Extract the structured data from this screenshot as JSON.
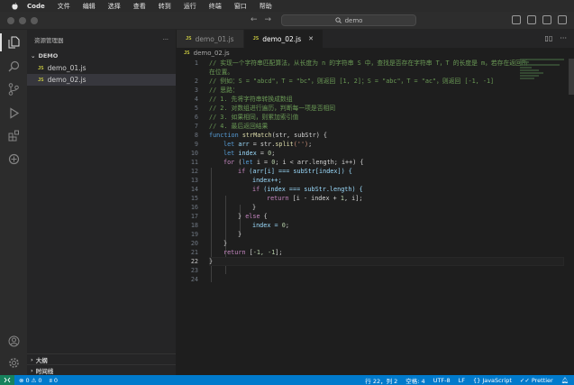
{
  "menubar": {
    "app": "Code",
    "items": [
      "文件",
      "编辑",
      "选择",
      "查看",
      "转到",
      "运行",
      "终端",
      "窗口",
      "帮助"
    ]
  },
  "titlebar": {
    "search": "demo"
  },
  "sidebar": {
    "title": "资源管理器",
    "section": "DEMO",
    "files": [
      {
        "badge": "JS",
        "name": "demo_01.js"
      },
      {
        "badge": "JS",
        "name": "demo_02.js"
      }
    ],
    "bottom": [
      "大纲",
      "时间线"
    ]
  },
  "tabs": [
    {
      "badge": "JS",
      "label": "demo_01.js"
    },
    {
      "badge": "JS",
      "label": "demo_02.js"
    }
  ],
  "breadcrumb": {
    "badge": "JS",
    "file": "demo_02.js"
  },
  "code": {
    "l1a": "// 实现一个字符串匹配算法，从长度为 n 的字符串 S 中，查找是否存在字符串 T，T 的长度是 m，若存在返回所",
    "l1b": "在位置。",
    "l2": "// 例如：S = \"abcd\"，T = \"bc\"，则返回 [1, 2]；S = \"abc\"，T = \"ac\"，则返回 [-1, -1]",
    "l3": "// 思路：",
    "l4": "// 1. 先将字符串转换成数组",
    "l5": "// 2. 对数组进行遍历，判断每一项是否相同",
    "l6": "// 3. 如果相同，则累加索引值",
    "l7": "// 4. 最后返回结果",
    "l8_kw": "function",
    "l8_fn": "strMatch",
    "l8_rest": "(str, subStr) {",
    "l9_kw": "let",
    "l9_var": "arr",
    "l9_mid": " = str.",
    "l9_fn": "split",
    "l9_str": "('')",
    "l9_end": ";",
    "l10_kw": "let",
    "l10_var": "index",
    "l10_mid": " = ",
    "l10_num": "0",
    "l10_end": ";",
    "l11_ctl": "for",
    "l11_a": " (",
    "l11_kw": "let",
    "l11_b": " i = ",
    "l11_num": "0",
    "l11_c": "; i < arr.length; i++) {",
    "l12_ctl": "if",
    "l12_rest": " (arr[i] === subStr[index]) {",
    "l13": "index++;",
    "l14_ctl": "if",
    "l14_rest": " (index === subStr.length) {",
    "l15_ctl": "return",
    "l15_a": " [i - index + ",
    "l15_num": "1",
    "l15_b": ", i];",
    "l16": "}",
    "l17_a": "} ",
    "l17_ctl": "else",
    "l17_b": " {",
    "l18_a": "index = ",
    "l18_num": "0",
    "l18_b": ";",
    "l19": "}",
    "l20": "}",
    "l21_ctl": "return",
    "l21_a": " [",
    "l21_num": "-1, -1",
    "l21_b": "];",
    "l22": "}",
    "line_numbers": [
      "1",
      "2",
      "3",
      "4",
      "5",
      "6",
      "7",
      "8",
      "9",
      "10",
      "11",
      "12",
      "13",
      "14",
      "15",
      "16",
      "17",
      "18",
      "19",
      "20",
      "21",
      "22",
      "23",
      "24"
    ]
  },
  "statusbar": {
    "errors": "0",
    "warnings": "0",
    "ports": "0",
    "position": "行 22，列 2",
    "spaces": "空格: 4",
    "encoding": "UTF-8",
    "eol": "LF",
    "language": "JavaScript",
    "formatter": "Prettier"
  }
}
